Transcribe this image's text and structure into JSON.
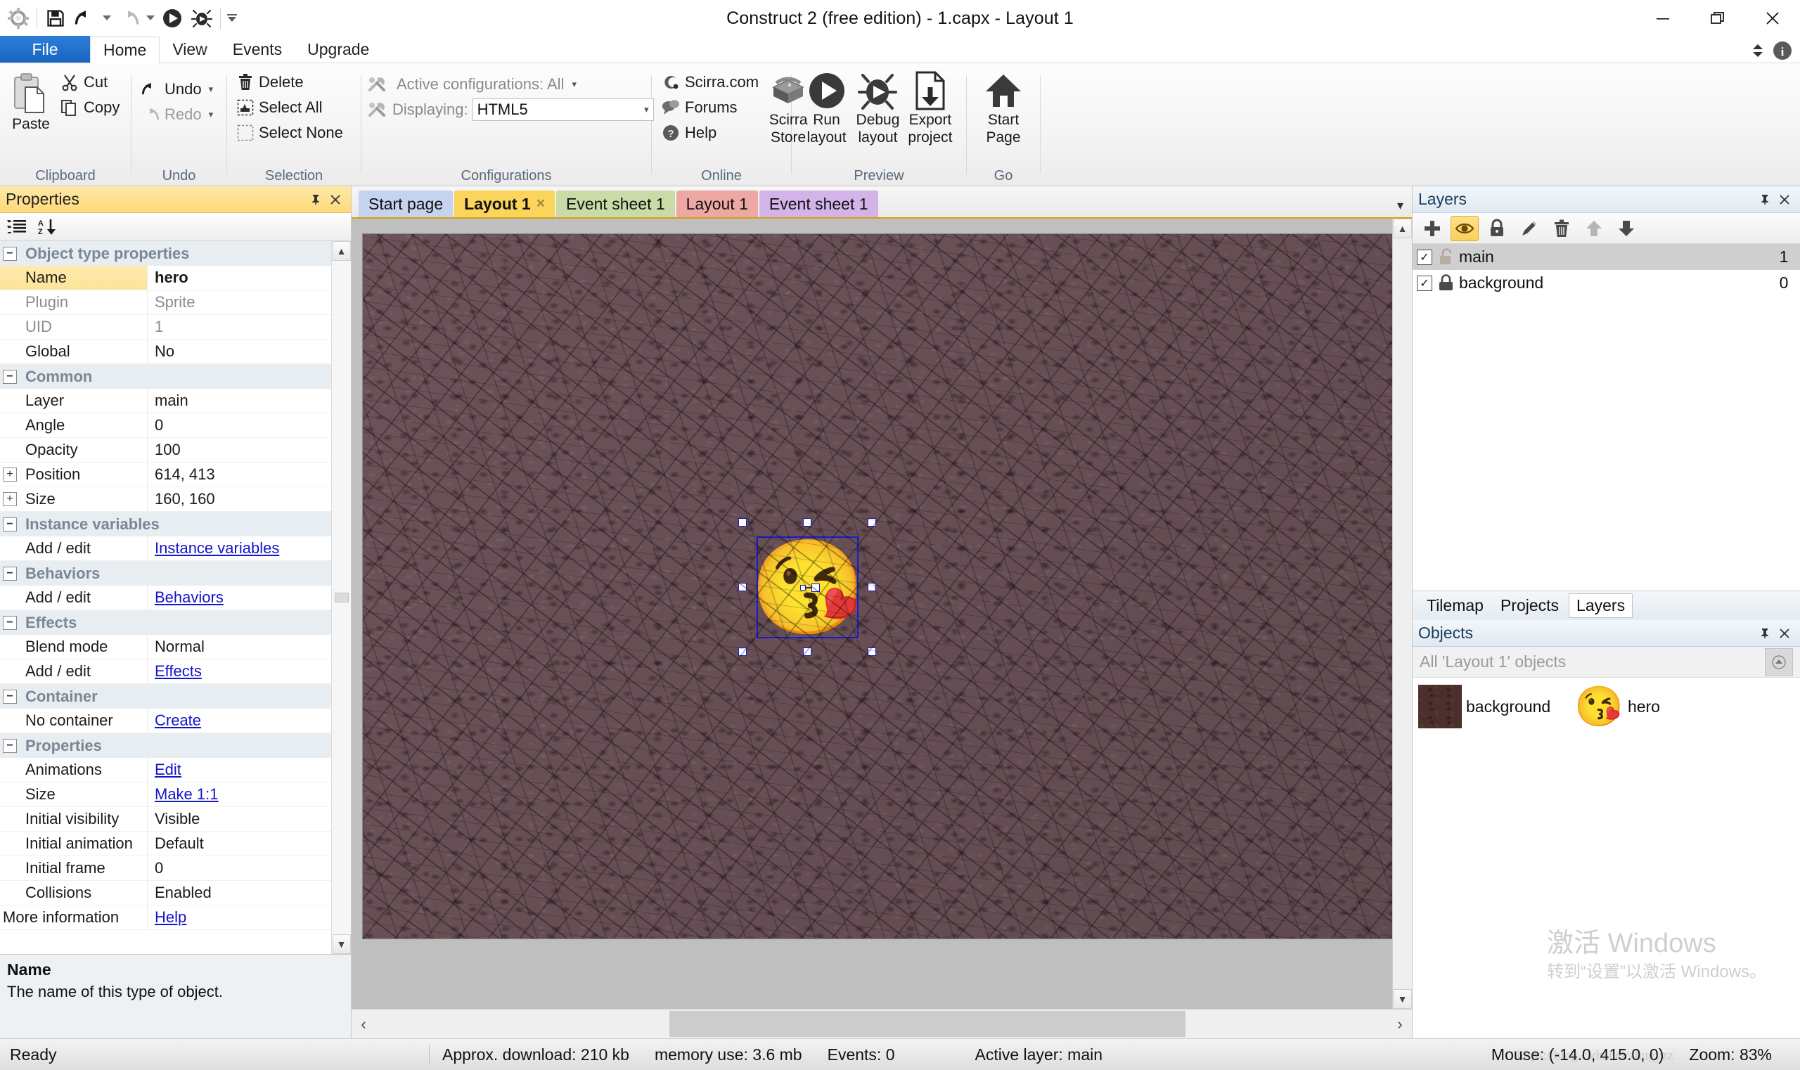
{
  "window": {
    "title": "Construct 2  (free edition) - 1.capx - Layout 1",
    "minimize": "minimize-icon",
    "maximize": "restore-icon",
    "close": "close-icon"
  },
  "quick_access": {
    "items": [
      {
        "name": "app-logo",
        "label": ""
      },
      {
        "name": "save-icon",
        "label": ""
      },
      {
        "name": "undo-icon",
        "label": ""
      },
      {
        "name": "redo-icon",
        "label": ""
      },
      {
        "name": "run-icon",
        "label": ""
      },
      {
        "name": "debug-icon",
        "label": ""
      },
      {
        "name": "customize-icon",
        "label": ""
      }
    ]
  },
  "ribbon": {
    "file_tab": "File",
    "tabs": [
      {
        "label": "Home",
        "active": true
      },
      {
        "label": "View",
        "active": false
      },
      {
        "label": "Events",
        "active": false
      },
      {
        "label": "Upgrade",
        "active": false
      }
    ],
    "groups": {
      "clipboard": {
        "label": "Clipboard",
        "paste": "Paste",
        "cut": "Cut",
        "copy": "Copy"
      },
      "undo": {
        "label": "Undo",
        "undo": "Undo",
        "redo": "Redo"
      },
      "selection": {
        "label": "Selection",
        "delete": "Delete",
        "select_all": "Select All",
        "select_none": "Select None"
      },
      "configurations": {
        "label": "Configurations",
        "active_configurations_label": "Active configurations: All",
        "displaying_label": "Displaying:",
        "displaying_value": "HTML5"
      },
      "online": {
        "label": "Online",
        "scirra_com": "Scirra.com",
        "forums": "Forums",
        "help": "Help",
        "scirra_store_line1": "Scirra",
        "scirra_store_line2": "Store"
      },
      "preview": {
        "label": "Preview",
        "run_line1": "Run",
        "run_line2": "layout",
        "debug_line1": "Debug",
        "debug_line2": "layout",
        "export_line1": "Export",
        "export_line2": "project"
      },
      "go": {
        "label": "Go",
        "start_line1": "Start",
        "start_line2": "Page"
      }
    }
  },
  "properties_panel": {
    "title": "Properties",
    "pin_icon": "pin-icon",
    "close_icon": "close-icon",
    "toolbar": {
      "categorize_icon": "categorize-icon",
      "sort_az_icon": "sort-alphabetical-icon"
    },
    "sections": [
      {
        "title": "Object type properties",
        "rows": [
          {
            "key": "Name",
            "value": "hero",
            "style": "bold",
            "selected": true
          },
          {
            "key": "Plugin",
            "value": "Sprite",
            "style": "dim"
          },
          {
            "key": "UID",
            "value": "1",
            "style": "dim"
          },
          {
            "key": "Global",
            "value": "No",
            "style": "normal"
          }
        ]
      },
      {
        "title": "Common",
        "rows": [
          {
            "key": "Layer",
            "value": "main",
            "style": "normal"
          },
          {
            "key": "Angle",
            "value": "0",
            "style": "normal"
          },
          {
            "key": "Opacity",
            "value": "100",
            "style": "normal"
          },
          {
            "key": "Position",
            "value": "614, 413",
            "style": "normal",
            "expander": "+"
          },
          {
            "key": "Size",
            "value": "160, 160",
            "style": "normal",
            "expander": "+"
          }
        ]
      },
      {
        "title": "Instance variables",
        "rows": [
          {
            "key": "Add / edit",
            "value": "Instance variables",
            "style": "link"
          }
        ]
      },
      {
        "title": "Behaviors",
        "rows": [
          {
            "key": "Add / edit",
            "value": "Behaviors",
            "style": "link"
          }
        ]
      },
      {
        "title": "Effects",
        "rows": [
          {
            "key": "Blend mode",
            "value": "Normal",
            "style": "normal"
          },
          {
            "key": "Add / edit",
            "value": "Effects",
            "style": "link"
          }
        ]
      },
      {
        "title": "Container",
        "rows": [
          {
            "key": "No container",
            "value": "Create",
            "style": "link"
          }
        ]
      },
      {
        "title": "Properties",
        "rows": [
          {
            "key": "Animations",
            "value": "Edit",
            "style": "link"
          },
          {
            "key": "Size",
            "value": "Make 1:1",
            "style": "link"
          },
          {
            "key": "Initial visibility",
            "value": "Visible",
            "style": "normal"
          },
          {
            "key": "Initial animation",
            "value": "Default",
            "style": "normal"
          },
          {
            "key": "Initial frame",
            "value": "0",
            "style": "normal"
          },
          {
            "key": "Collisions",
            "value": "Enabled",
            "style": "normal"
          }
        ]
      }
    ],
    "more_information": {
      "key": "More information",
      "value": "Help"
    },
    "description": {
      "title": "Name",
      "text": "The name of this type of object."
    }
  },
  "document_tabs": [
    {
      "label": "Start page",
      "color": "#c6d3ee",
      "active": false,
      "closable": false
    },
    {
      "label": "Layout 1",
      "color": "#fbd45b",
      "active": true,
      "closable": true,
      "close_label": "×"
    },
    {
      "label": "Event sheet 1",
      "color": "#c9dba6",
      "active": false,
      "closable": false
    },
    {
      "label": "Layout 1",
      "color": "#eda8a4",
      "active": false,
      "closable": false
    },
    {
      "label": "Event sheet 1",
      "color": "#d3b4e8",
      "active": false,
      "closable": false
    }
  ],
  "canvas": {
    "selected_object": "hero",
    "sprite_glyph": "😘",
    "selection_color": "#1a1ad0"
  },
  "layers_panel": {
    "title": "Layers",
    "pin_icon": "pin-icon",
    "close_icon": "close-icon",
    "toolbar": [
      {
        "name": "add-layer-icon",
        "active": false
      },
      {
        "name": "eye-visibility-icon",
        "active": true
      },
      {
        "name": "lock-icon",
        "active": false
      },
      {
        "name": "rename-pencil-icon",
        "active": false
      },
      {
        "name": "delete-trash-icon",
        "active": false
      },
      {
        "name": "move-up-icon",
        "active": false
      },
      {
        "name": "move-down-icon",
        "active": false
      }
    ],
    "columns": [
      "name",
      "index"
    ],
    "rows": [
      {
        "checked": true,
        "locked": false,
        "name": "main",
        "index": "1",
        "selected": true
      },
      {
        "checked": true,
        "locked": true,
        "name": "background",
        "index": "0",
        "selected": false
      }
    ]
  },
  "bottom_tabs": [
    {
      "label": "Tilemap",
      "active": false
    },
    {
      "label": "Projects",
      "active": false
    },
    {
      "label": "Layers",
      "active": true
    }
  ],
  "objects_panel": {
    "title": "Objects",
    "pin_icon": "pin-icon",
    "close_icon": "close-icon",
    "filter_label": "All 'Layout 1' objects",
    "collapse_icon": "collapse-up-icon",
    "items": [
      {
        "label": "background",
        "thumb": "texture-thumb"
      },
      {
        "label": "hero",
        "thumb": "😘"
      }
    ]
  },
  "windows_watermark": {
    "line1": "激活 Windows",
    "line2": "转到“设置”以激活 Windows。"
  },
  "status_bar": {
    "ready": "Ready",
    "download": "Approx. download: 210 kb",
    "memory": "memory use: 3.6 mb",
    "events": "Events: 0",
    "active_layer": "Active layer: main",
    "mouse": "Mouse: (-14.0, 415.0, 0)",
    "zoom": "Zoom: 83%",
    "watermark": "https://blog.csdn.net/zhugyzz"
  },
  "colors": {
    "accent_yellow": "#fdd978",
    "file_tab_blue": "#1565c0",
    "selection_blue": "#1a1ad0",
    "link_blue": "#1414cc"
  }
}
